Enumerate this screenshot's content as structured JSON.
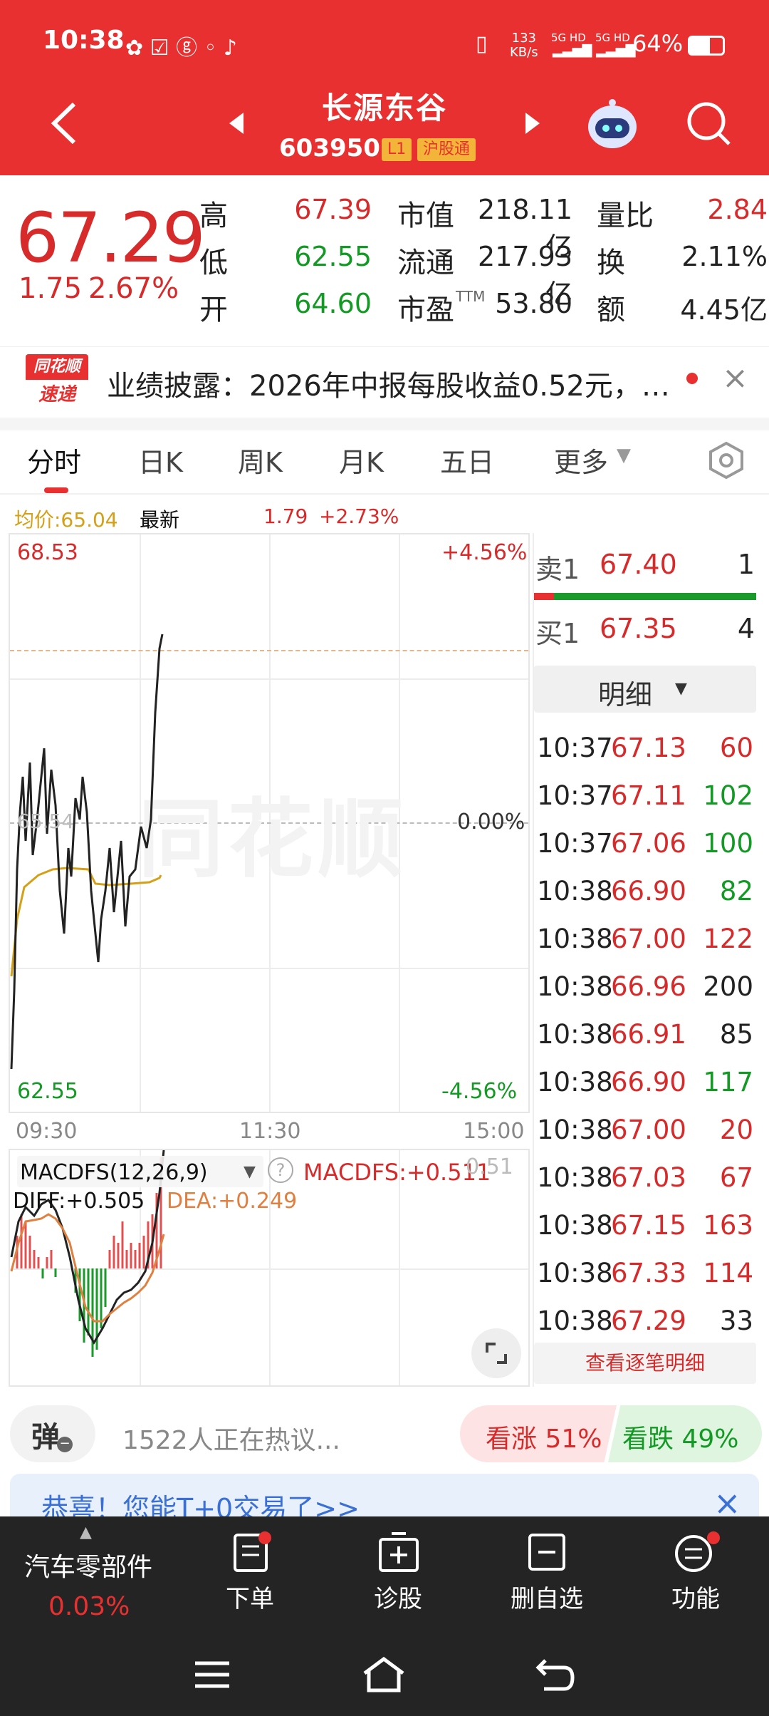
{
  "status": {
    "time": "10:38",
    "speed_top": "133",
    "speed_bot": "KB/s",
    "net1": "5G HD",
    "net2": "5G HD",
    "battery": "64%"
  },
  "header": {
    "name": "长源东谷",
    "code": "603950",
    "level": "L1",
    "exchange": "沪股通"
  },
  "quote": {
    "price": "67.29",
    "change": "1.75",
    "change_pct": "2.67%",
    "high_label": "高",
    "high": "67.39",
    "low_label": "低",
    "low": "62.55",
    "open_label": "开",
    "open": "64.60",
    "mcap_label": "市值",
    "mcap": "218.11亿",
    "float_label": "流通",
    "float": "217.93亿",
    "pe_label": "市盈",
    "pe_sup": "TTM",
    "pe": "53.80",
    "vr_label": "量比",
    "vr": "2.84",
    "turn_label": "换",
    "turn": "2.11%",
    "amt_label": "额",
    "amt": "4.45亿"
  },
  "notice": {
    "logo_top": "同花顺",
    "logo_bot": "速递",
    "text": "业绩披露：2026年中报每股收益0.52元，…"
  },
  "tabs": [
    "分时",
    "日K",
    "周K",
    "月K",
    "五日",
    "更多"
  ],
  "chart_info": {
    "avg": "均价:65.04",
    "latest": "最新",
    "change": "1.79",
    "pct": "+2.73%"
  },
  "chart": {
    "ymax": "68.53",
    "ymin": "62.55",
    "pmax": "+4.56%",
    "pmin": "-4.56%",
    "mid": "65.54",
    "midpct": "0.00%",
    "watermark": "同花顺",
    "t0": "09:30",
    "t1": "11:30",
    "t2": "15:00"
  },
  "macd": {
    "name": "MACDFS(12,26,9)",
    "val": "MACDFS:+0.511",
    "diff": "DIFF:+0.505",
    "dea": "DEA:+0.249",
    "ytop": "0.51"
  },
  "orderbook": {
    "sell_label": "卖1",
    "sell_price": "67.40",
    "sell_vol": "1",
    "buy_label": "买1",
    "buy_price": "67.35",
    "buy_vol": "4",
    "detail": "明细",
    "view_all": "查看逐笔明细",
    "ticks": [
      [
        "10:37",
        "67.13",
        "60",
        "r"
      ],
      [
        "10:37",
        "67.11",
        "102",
        "g"
      ],
      [
        "10:37",
        "67.06",
        "100",
        "g"
      ],
      [
        "10:38",
        "66.90",
        "82",
        "g"
      ],
      [
        "10:38",
        "67.00",
        "122",
        "r"
      ],
      [
        "10:38",
        "66.96",
        "200",
        "k"
      ],
      [
        "10:38",
        "66.91",
        "85",
        "k"
      ],
      [
        "10:38",
        "66.90",
        "117",
        "g"
      ],
      [
        "10:38",
        "67.00",
        "20",
        "r"
      ],
      [
        "10:38",
        "67.03",
        "67",
        "r"
      ],
      [
        "10:38",
        "67.15",
        "163",
        "r"
      ],
      [
        "10:38",
        "67.33",
        "114",
        "r"
      ],
      [
        "10:38",
        "67.29",
        "33",
        "k"
      ]
    ]
  },
  "social": {
    "dan": "弹",
    "hot": "1522人正在热议...",
    "up": "看涨 51%",
    "down": "看跌 49%"
  },
  "promo": "恭喜！您能T+0交易了>>",
  "bottom": {
    "sector": "汽车零部件",
    "sector_pct": "0.03%",
    "order": "下单",
    "diag": "诊股",
    "del": "删自选",
    "func": "功能"
  },
  "colors": {
    "header": "#e93030",
    "up": "#d72b2b",
    "down": "#139a24"
  }
}
